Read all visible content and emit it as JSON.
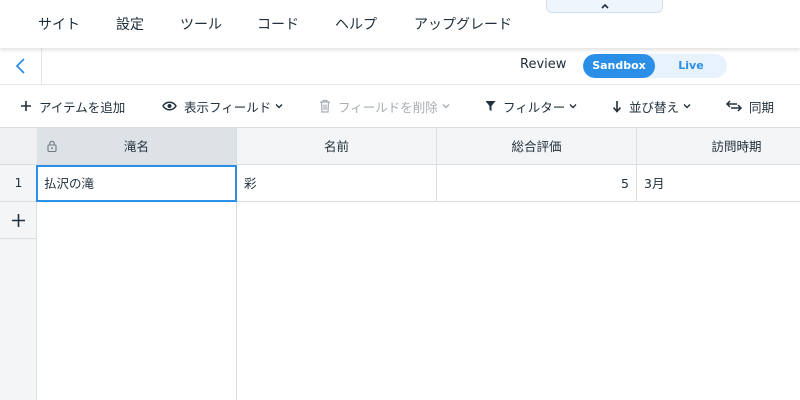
{
  "menu": {
    "items": [
      "サイト",
      "設定",
      "ツール",
      "コード",
      "ヘルプ",
      "アップグレード"
    ]
  },
  "reviewbar": {
    "label": "Review",
    "toggle": {
      "sandbox": "Sandbox",
      "live": "Live",
      "selected": "Sandbox"
    }
  },
  "toolbar": {
    "add_item": "アイテムを追加",
    "display_fields": "表示フィールド",
    "delete_field": "フィールドを削除",
    "filter": "フィルター",
    "sort": "並び替え",
    "sync": "同期"
  },
  "table": {
    "columns": [
      "滝名",
      "名前",
      "総合評価",
      "訪問時期"
    ],
    "rows": [
      {
        "num": "1",
        "cells": [
          "払沢の滝",
          "彩",
          "5",
          "3月"
        ]
      }
    ]
  },
  "colors": {
    "accent": "#2b8fe8",
    "header_bg": "#f4f5f6",
    "primary_header_bg": "#dde2e7"
  },
  "icons": [
    "chevron-up-icon",
    "back-arrow-icon",
    "plus-icon",
    "eye-icon",
    "trash-icon",
    "filter-icon",
    "sort-down-icon",
    "sync-icon",
    "lock-icon",
    "chevron-down-icon"
  ]
}
